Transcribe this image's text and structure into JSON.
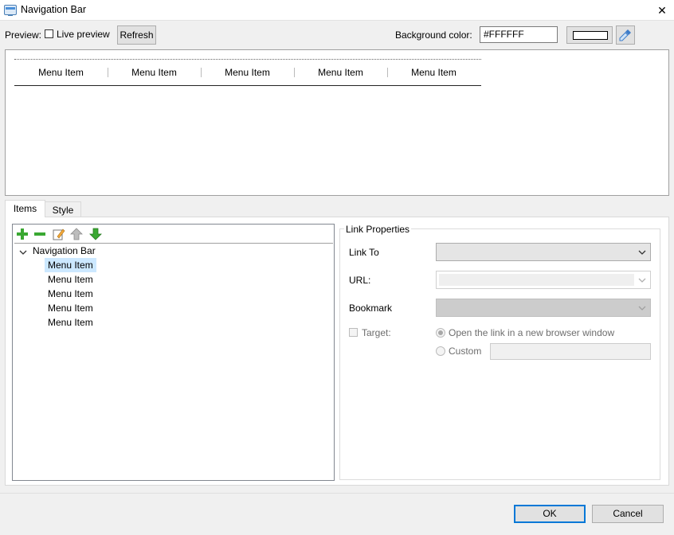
{
  "window": {
    "title": "Navigation Bar",
    "close_glyph": "✕"
  },
  "preview_bar": {
    "preview_label": "Preview:",
    "live_preview_label": "Live preview",
    "live_preview_checked": false,
    "refresh_label": "Refresh",
    "background_label": "Background color:",
    "background_value": "#FFFFFF"
  },
  "nav_preview": {
    "items": [
      "Menu Item",
      "Menu Item",
      "Menu Item",
      "Menu Item",
      "Menu Item"
    ]
  },
  "tabs": [
    {
      "label": "Items",
      "active": true
    },
    {
      "label": "Style",
      "active": false
    }
  ],
  "tree": {
    "toolbar_icons": [
      "add-icon",
      "remove-icon",
      "edit-icon",
      "move-up-icon",
      "move-down-icon"
    ],
    "root_label": "Navigation Bar",
    "children": [
      "Menu Item",
      "Menu Item",
      "Menu Item",
      "Menu Item",
      "Menu Item"
    ],
    "selected_index": 0
  },
  "link_properties": {
    "title": "Link Properties",
    "link_to_label": "Link To",
    "link_to_value": "",
    "url_label": "URL:",
    "url_value": "",
    "bookmark_label": "Bookmark",
    "bookmark_value": "",
    "target_label": "Target:",
    "target_checked": false,
    "radio_new_window_label": "Open the link in a new browser window",
    "radio_custom_label": "Custom",
    "custom_value": ""
  },
  "footer": {
    "ok_label": "OK",
    "cancel_label": "Cancel"
  },
  "colors": {
    "accent": "#0078d7",
    "selection": "#cce8ff",
    "green": "#3aa832"
  }
}
